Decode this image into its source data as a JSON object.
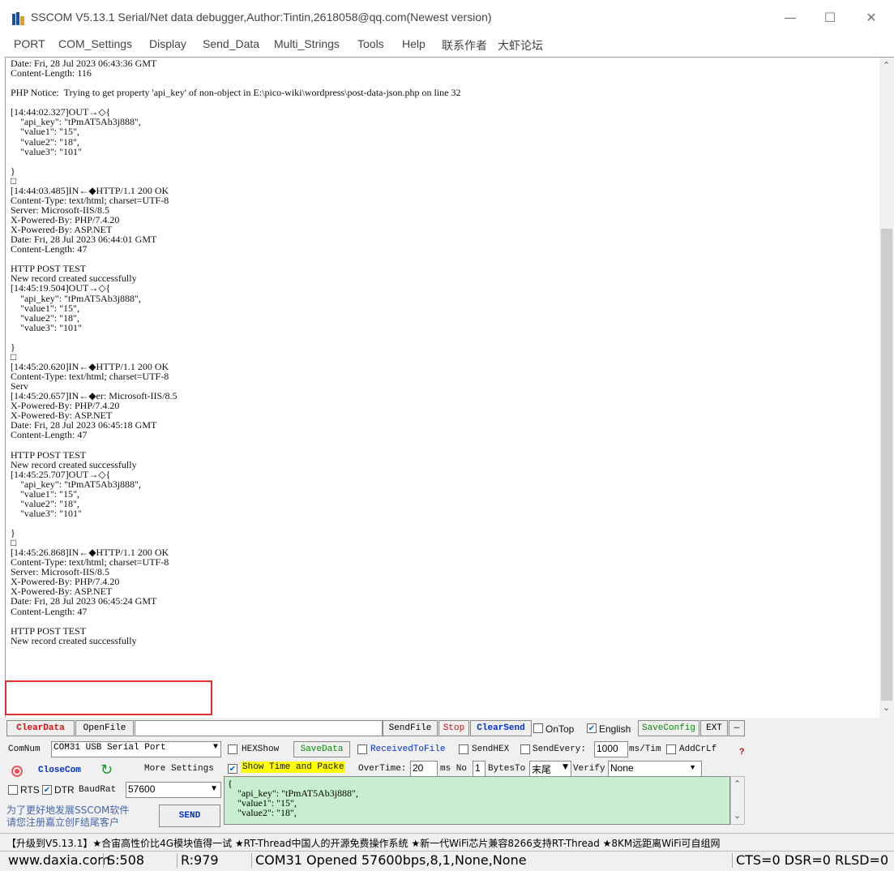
{
  "window": {
    "title": "SSCOM V5.13.1 Serial/Net data debugger,Author:Tintin,2618058@qq.com(Newest version)",
    "minimize_glyph": "—",
    "maximize_glyph": "☐",
    "close_glyph": "✕"
  },
  "menu": {
    "items": [
      "PORT",
      "COM_Settings",
      "Display",
      "Send_Data",
      "Multi_Strings",
      "Tools",
      "Help",
      "联系作者",
      "大虾论坛"
    ]
  },
  "log": {
    "lines": [
      "Date: Fri, 28 Jul 2023 06:43:36 GMT",
      "Content-Length: 116",
      "",
      "PHP Notice:  Trying to get property 'api_key' of non-object in E:\\pico-wiki\\wordpress\\post-data-json.php on line 32",
      "",
      "[14:44:02.327]OUT→◇{",
      "    \"api_key\": \"tPmAT5Ab3j888\",",
      "    \"value1\": \"15\",",
      "    \"value2\": \"18\",",
      "    \"value3\": \"101\"",
      "",
      "}",
      "□",
      "[14:44:03.485]IN←◆HTTP/1.1 200 OK",
      "Content-Type: text/html; charset=UTF-8",
      "Server: Microsoft-IIS/8.5",
      "X-Powered-By: PHP/7.4.20",
      "X-Powered-By: ASP.NET",
      "Date: Fri, 28 Jul 2023 06:44:01 GMT",
      "Content-Length: 47",
      "",
      "HTTP POST TEST",
      "New record created successfully",
      "[14:45:19.504]OUT→◇{",
      "    \"api_key\": \"tPmAT5Ab3j888\",",
      "    \"value1\": \"15\",",
      "    \"value2\": \"18\",",
      "    \"value3\": \"101\"",
      "",
      "}",
      "□",
      "[14:45:20.620]IN←◆HTTP/1.1 200 OK",
      "Content-Type: text/html; charset=UTF-8",
      "Serv",
      "[14:45:20.657]IN←◆er: Microsoft-IIS/8.5",
      "X-Powered-By: PHP/7.4.20",
      "X-Powered-By: ASP.NET",
      "Date: Fri, 28 Jul 2023 06:45:18 GMT",
      "Content-Length: 47",
      "",
      "HTTP POST TEST",
      "New record created successfully",
      "[14:45:25.707]OUT→◇{",
      "    \"api_key\": \"tPmAT5Ab3j888\",",
      "    \"value1\": \"15\",",
      "    \"value2\": \"18\",",
      "    \"value3\": \"101\"",
      "",
      "}",
      "□",
      "[14:45:26.868]IN←◆HTTP/1.1 200 OK",
      "Content-Type: text/html; charset=UTF-8",
      "Server: Microsoft-IIS/8.5",
      "X-Powered-By: PHP/7.4.20",
      "X-Powered-By: ASP.NET",
      "Date: Fri, 28 Jul 2023 06:45:24 GMT",
      "Content-Length: 47",
      "",
      "HTTP POST TEST",
      "New record created successfully"
    ]
  },
  "toolbar1": {
    "clear_data": "ClearData",
    "open_file": "OpenFile",
    "file_path": "",
    "send_file": "SendFile",
    "stop": "Stop",
    "clear_send": "ClearSend",
    "on_top": "OnTop",
    "on_top_checked": false,
    "english": "English",
    "english_checked": true,
    "save_config": "SaveConfig",
    "ext": "EXT",
    "dash": "—"
  },
  "toolbar2": {
    "com_num_label": "ComNum",
    "com_port": "COM31 USB Serial Port",
    "hex_show": "HEXShow",
    "save_data": "SaveData",
    "received_to_file": "ReceivedToFile",
    "send_hex": "SendHEX",
    "send_every": "SendEvery:",
    "send_every_value": "1000",
    "ms_tim": "ms/Tim",
    "add_crlf": "AddCrLf",
    "help_mark": "?"
  },
  "toolbar3": {
    "close_com": "CloseCom",
    "more_settings": "More Settings",
    "show_time": "Show Time and Packe",
    "show_time_checked": true,
    "overtime_label": "OverTime:",
    "overtime_value": "20",
    "ms_no": "ms No",
    "no_value": "1",
    "bytes_to": "BytesTo",
    "bytes_to_value": "末尾",
    "verify_label": "Verify",
    "verify_value": "None"
  },
  "toolbar4": {
    "rts": "RTS",
    "rts_checked": false,
    "dtr": "DTR",
    "dtr_checked": true,
    "baud_label": "BaudRat",
    "baud_value": "57600",
    "promo_line1": "为了更好地发展SSCOM软件",
    "promo_line2": "请您注册嘉立创F结尾客户",
    "send": "SEND"
  },
  "send_box": {
    "lines": [
      "{",
      "    \"api_key\": \"tPmAT5Ab3j888\",",
      "    \"value1\": \"15\",",
      "    \"value2\": \"18\","
    ]
  },
  "promo_bar": "【升级到V5.13.1】★合宙高性价比4G模块值得一试 ★RT-Thread中国人的开源免费操作系统 ★新一代WiFi芯片兼容8266支持RT-Thread ★8KM远距离WiFi可自组网",
  "status": {
    "site": "www.daxia.com",
    "sent": "S:508",
    "received": "R:979",
    "port_status": "COM31 Opened  57600bps,8,1,None,None",
    "signals": "CTS=0 DSR=0 RLSD=0"
  },
  "colors": {
    "highlight_box": "#e0302d",
    "send_box_bg": "#c7efcf",
    "panel_bg": "#f0f0f0"
  }
}
